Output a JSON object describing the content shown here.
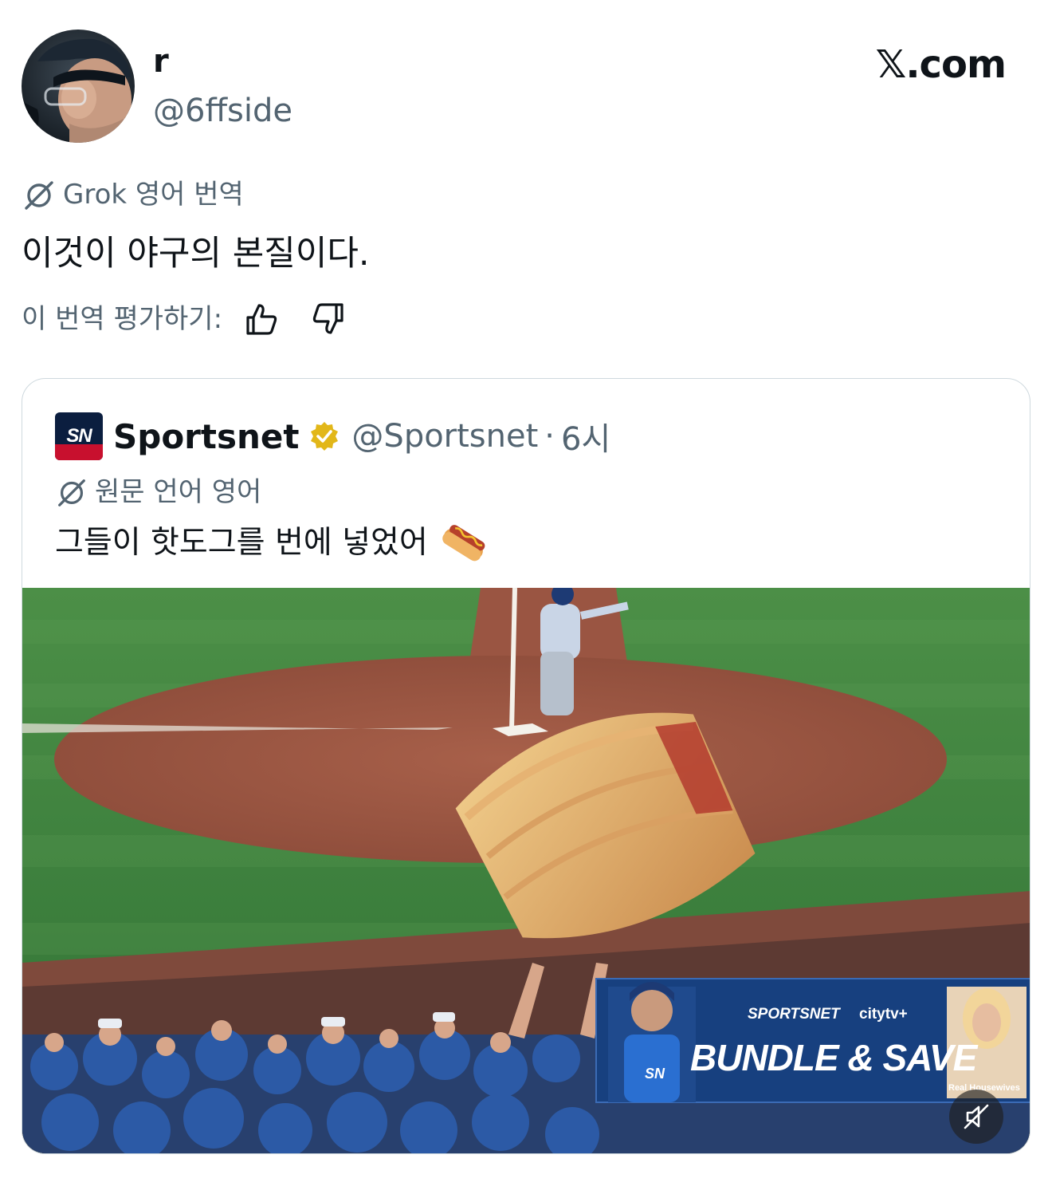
{
  "author": {
    "display_name": "r",
    "handle": "@6ffside",
    "avatar_icon": "profile-photo"
  },
  "brand": "𝕏.com",
  "translation": {
    "label": "Grok 영어 번역",
    "text": "이것이 야구의 본질이다.",
    "rate_label": "이 번역 평가하기:"
  },
  "quoted": {
    "logo_text": "SN",
    "name": "Sportsnet",
    "handle": "@Sportsnet",
    "separator": "·",
    "time": "6시",
    "original_language_label": "원문 언어 영어",
    "text": "그들이 핫도그를 번에 넣었어",
    "emoji": "hotdog-emoji",
    "media": {
      "ad_brand": "SPORTSNET",
      "ad_partner": "citytv+",
      "ad_headline": "BUNDLE & SAVE",
      "ad_sub": "Real Housewives",
      "jersey_logo": "SN"
    }
  },
  "colors": {
    "text": "#0f1419",
    "muted": "#536471",
    "border": "#cfd9de",
    "verified_gold": "#e2b719",
    "sportsnet_navy": "#0b1e3f",
    "sportsnet_red": "#c8102e"
  }
}
